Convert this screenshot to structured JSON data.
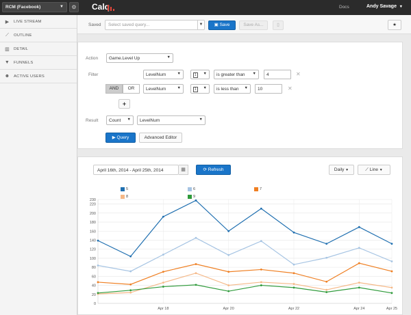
{
  "topbar": {
    "app_name": "RCM (Facebook)",
    "logo_text": "Calq",
    "docs_label": "Docs",
    "user_name": "Andy Savage",
    "user_caret": "▾"
  },
  "sidebar": {
    "items": [
      {
        "label": "LIVE STREAM",
        "icon": "play-icon",
        "glyph": "▶"
      },
      {
        "label": "OUTLINE",
        "icon": "line-chart-icon",
        "glyph": "⟋"
      },
      {
        "label": "DETAIL",
        "icon": "bar-chart-icon",
        "glyph": "▥"
      },
      {
        "label": "FUNNELS",
        "icon": "funnel-icon",
        "glyph": "▼"
      },
      {
        "label": "ACTIVE USERS",
        "icon": "users-icon",
        "glyph": "☻"
      }
    ]
  },
  "saved_bar": {
    "label": "Saved",
    "placeholder": "Select saved query...",
    "save_label": "Save",
    "save_as_label": "Save As...",
    "star_glyph": "★"
  },
  "query": {
    "action_label": "Action",
    "action_value": "Game.Level Up",
    "filter_label": "Filter",
    "filters": [
      {
        "property": "LevelNum",
        "type_glyph": "1",
        "operator": "is greater than",
        "value": "4"
      },
      {
        "property": "LevelNum",
        "type_glyph": "1",
        "operator": "is less than",
        "value": "10"
      }
    ],
    "and_label": "AND",
    "or_label": "OR",
    "add_glyph": "+",
    "result_label": "Result",
    "result_agg": "Count",
    "result_property": "LevelNum",
    "query_button": "Query",
    "advanced_button": "Advanced Editor"
  },
  "chart_panel": {
    "date_range": "April 16th, 2014 - April 25th, 2014",
    "refresh_label": "Refresh",
    "interval_label": "Daily",
    "chart_type_label": "Line"
  },
  "colors": {
    "s5": "#1f6fb0",
    "s6": "#a6c4e3",
    "s7": "#ef7f22",
    "s8": "#f5b887",
    "s9": "#2e9a3a"
  },
  "chart_data": {
    "type": "line",
    "x": [
      "Apr 16",
      "Apr 17",
      "Apr 18",
      "Apr 19",
      "Apr 20",
      "Apr 21",
      "Apr 22",
      "Apr 23",
      "Apr 24",
      "Apr 25"
    ],
    "xticks": [
      "Apr 18",
      "Apr 20",
      "Apr 22",
      "Apr 24",
      "Apr 25"
    ],
    "yticks": [
      0,
      20,
      40,
      60,
      80,
      100,
      120,
      140,
      160,
      180,
      200,
      220,
      230
    ],
    "ylim": [
      0,
      230
    ],
    "grid": true,
    "legend_position": "top",
    "series": [
      {
        "name": "5",
        "color": "#1f6fb0",
        "values": [
          139,
          104,
          192,
          228,
          160,
          210,
          157,
          132,
          169,
          132
        ]
      },
      {
        "name": "6",
        "color": "#a6c4e3",
        "values": [
          84,
          71,
          108,
          145,
          107,
          138,
          86,
          101,
          123,
          93
        ]
      },
      {
        "name": "7",
        "color": "#ef7f22",
        "values": [
          47,
          42,
          70,
          87,
          70,
          75,
          67,
          48,
          89,
          71
        ]
      },
      {
        "name": "8",
        "color": "#f5b887",
        "values": [
          21,
          24,
          46,
          67,
          40,
          47,
          43,
          30,
          46,
          35
        ]
      },
      {
        "name": "9",
        "color": "#2e9a3a",
        "values": [
          23,
          29,
          37,
          41,
          27,
          40,
          35,
          25,
          35,
          23
        ]
      }
    ]
  }
}
